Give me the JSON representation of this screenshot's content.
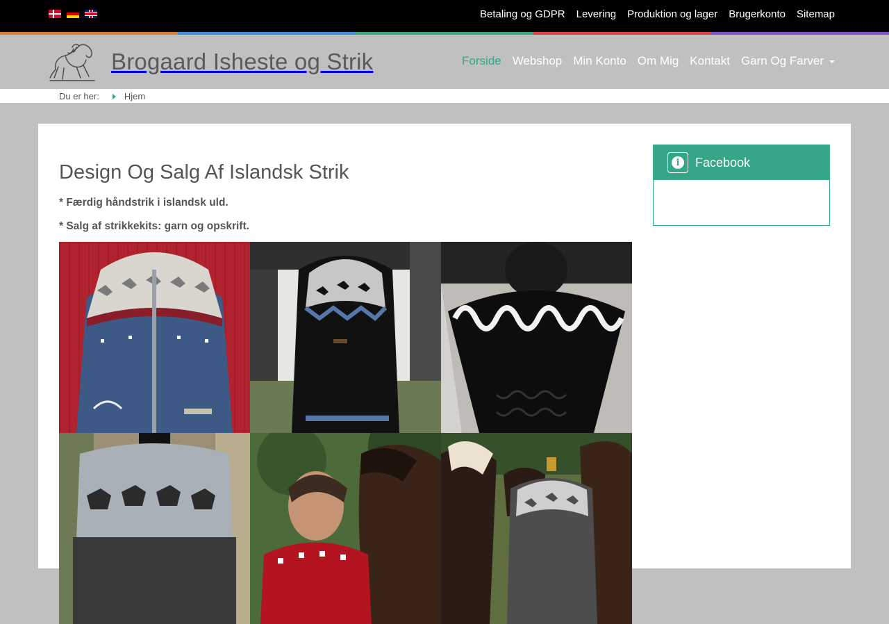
{
  "topbar": {
    "languages": [
      {
        "code": "dk",
        "icon": "danish-flag-icon"
      },
      {
        "code": "de",
        "icon": "german-flag-icon"
      },
      {
        "code": "gb",
        "icon": "british-flag-icon"
      }
    ],
    "links": [
      "Betaling og GDPR",
      "Levering",
      "Produktion og lager",
      "Brugerkonto",
      "Sitemap"
    ]
  },
  "colorstrip": [
    "#e07b39",
    "#3a8ee6",
    "#35a788",
    "#d64541",
    "#7d4fd1"
  ],
  "header": {
    "site_title": "Brogaard Isheste og Strik",
    "nav": [
      "Forside",
      "Webshop",
      "Min Konto",
      "Om Mig",
      "Kontakt",
      "Garn Og Farver"
    ],
    "active_nav": "Forside",
    "accent": "#35a788"
  },
  "breadcrumb": {
    "prefix": "Du er her:",
    "current": "Hjem"
  },
  "main": {
    "title": "Design Og Salg Af Islandsk Strik",
    "lines": [
      "* Færdig håndstrik i islandsk uld.",
      "* Salg af strikkekits: garn og opskrift."
    ],
    "photos": [
      "blue-lopapeysa-cardigan-photo",
      "black-long-sweater-photo",
      "black-white-sweater-on-mannequin-photo",
      "grey-horse-pattern-sweater-photo",
      "woman-with-icelandic-horse-photo",
      "horses-with-sweater-photo"
    ]
  },
  "sidebar": {
    "widget_title": "Facebook",
    "widget_icon": "info-icon"
  }
}
